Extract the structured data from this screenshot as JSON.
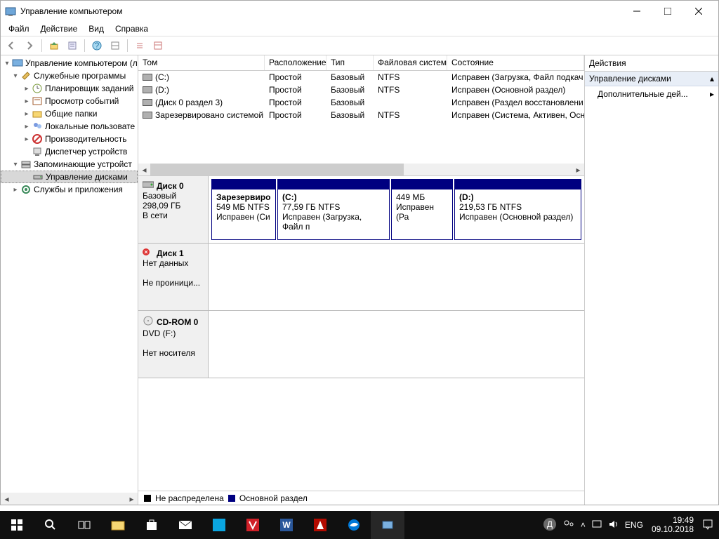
{
  "title": "Управление компьютером",
  "menu": {
    "file": "Файл",
    "action": "Действие",
    "view": "Вид",
    "help": "Справка"
  },
  "tree": {
    "root": "Управление компьютером (л",
    "system_tools": "Служебные программы",
    "task_scheduler": "Планировщик заданий",
    "event_viewer": "Просмотр событий",
    "shared_folders": "Общие папки",
    "local_users": "Локальные пользовате",
    "performance": "Производительность",
    "device_manager": "Диспетчер устройств",
    "storage": "Запоминающие устройст",
    "disk_management": "Управление дисками",
    "services": "Службы и приложения"
  },
  "vol_headers": {
    "volume": "Том",
    "layout": "Расположение",
    "type": "Тип",
    "fs": "Файловая система",
    "status": "Состояние"
  },
  "volumes": [
    {
      "name": "(C:)",
      "layout": "Простой",
      "type": "Базовый",
      "fs": "NTFS",
      "status": "Исправен (Загрузка, Файл подкач"
    },
    {
      "name": "(D:)",
      "layout": "Простой",
      "type": "Базовый",
      "fs": "NTFS",
      "status": "Исправен (Основной раздел)"
    },
    {
      "name": "(Диск 0 раздел 3)",
      "layout": "Простой",
      "type": "Базовый",
      "fs": "",
      "status": "Исправен (Раздел восстановлени"
    },
    {
      "name": "Зарезервировано системой",
      "layout": "Простой",
      "type": "Базовый",
      "fs": "NTFS",
      "status": "Исправен (Система, Активен, Осн"
    }
  ],
  "disks": {
    "d0": {
      "title": "Диск 0",
      "type": "Базовый",
      "size": "298,09 ГБ",
      "status": "В сети",
      "p0": {
        "name": "Зарезервиро",
        "size": "549 МБ NTFS",
        "status": "Исправен (Си"
      },
      "p1": {
        "name": "(C:)",
        "size": "77,59 ГБ NTFS",
        "status": "Исправен (Загрузка, Файл п"
      },
      "p2": {
        "name": "",
        "size": "449 МБ",
        "status": "Исправен (Ра"
      },
      "p3": {
        "name": "(D:)",
        "size": "219,53 ГБ NTFS",
        "status": "Исправен (Основной раздел)"
      }
    },
    "d1": {
      "title": "Диск 1",
      "type": "Нет данных",
      "status": "Не проиници..."
    },
    "cd": {
      "title": "CD-ROM 0",
      "type": "DVD (F:)",
      "status": "Нет носителя"
    }
  },
  "legend": {
    "unalloc": "Не распределена",
    "primary": "Основной раздел"
  },
  "actions": {
    "header": "Действия",
    "group": "Управление дисками",
    "more": "Дополнительные дей..."
  },
  "taskbar": {
    "lang": "ENG",
    "time": "19:49",
    "date": "09.10.2018"
  }
}
